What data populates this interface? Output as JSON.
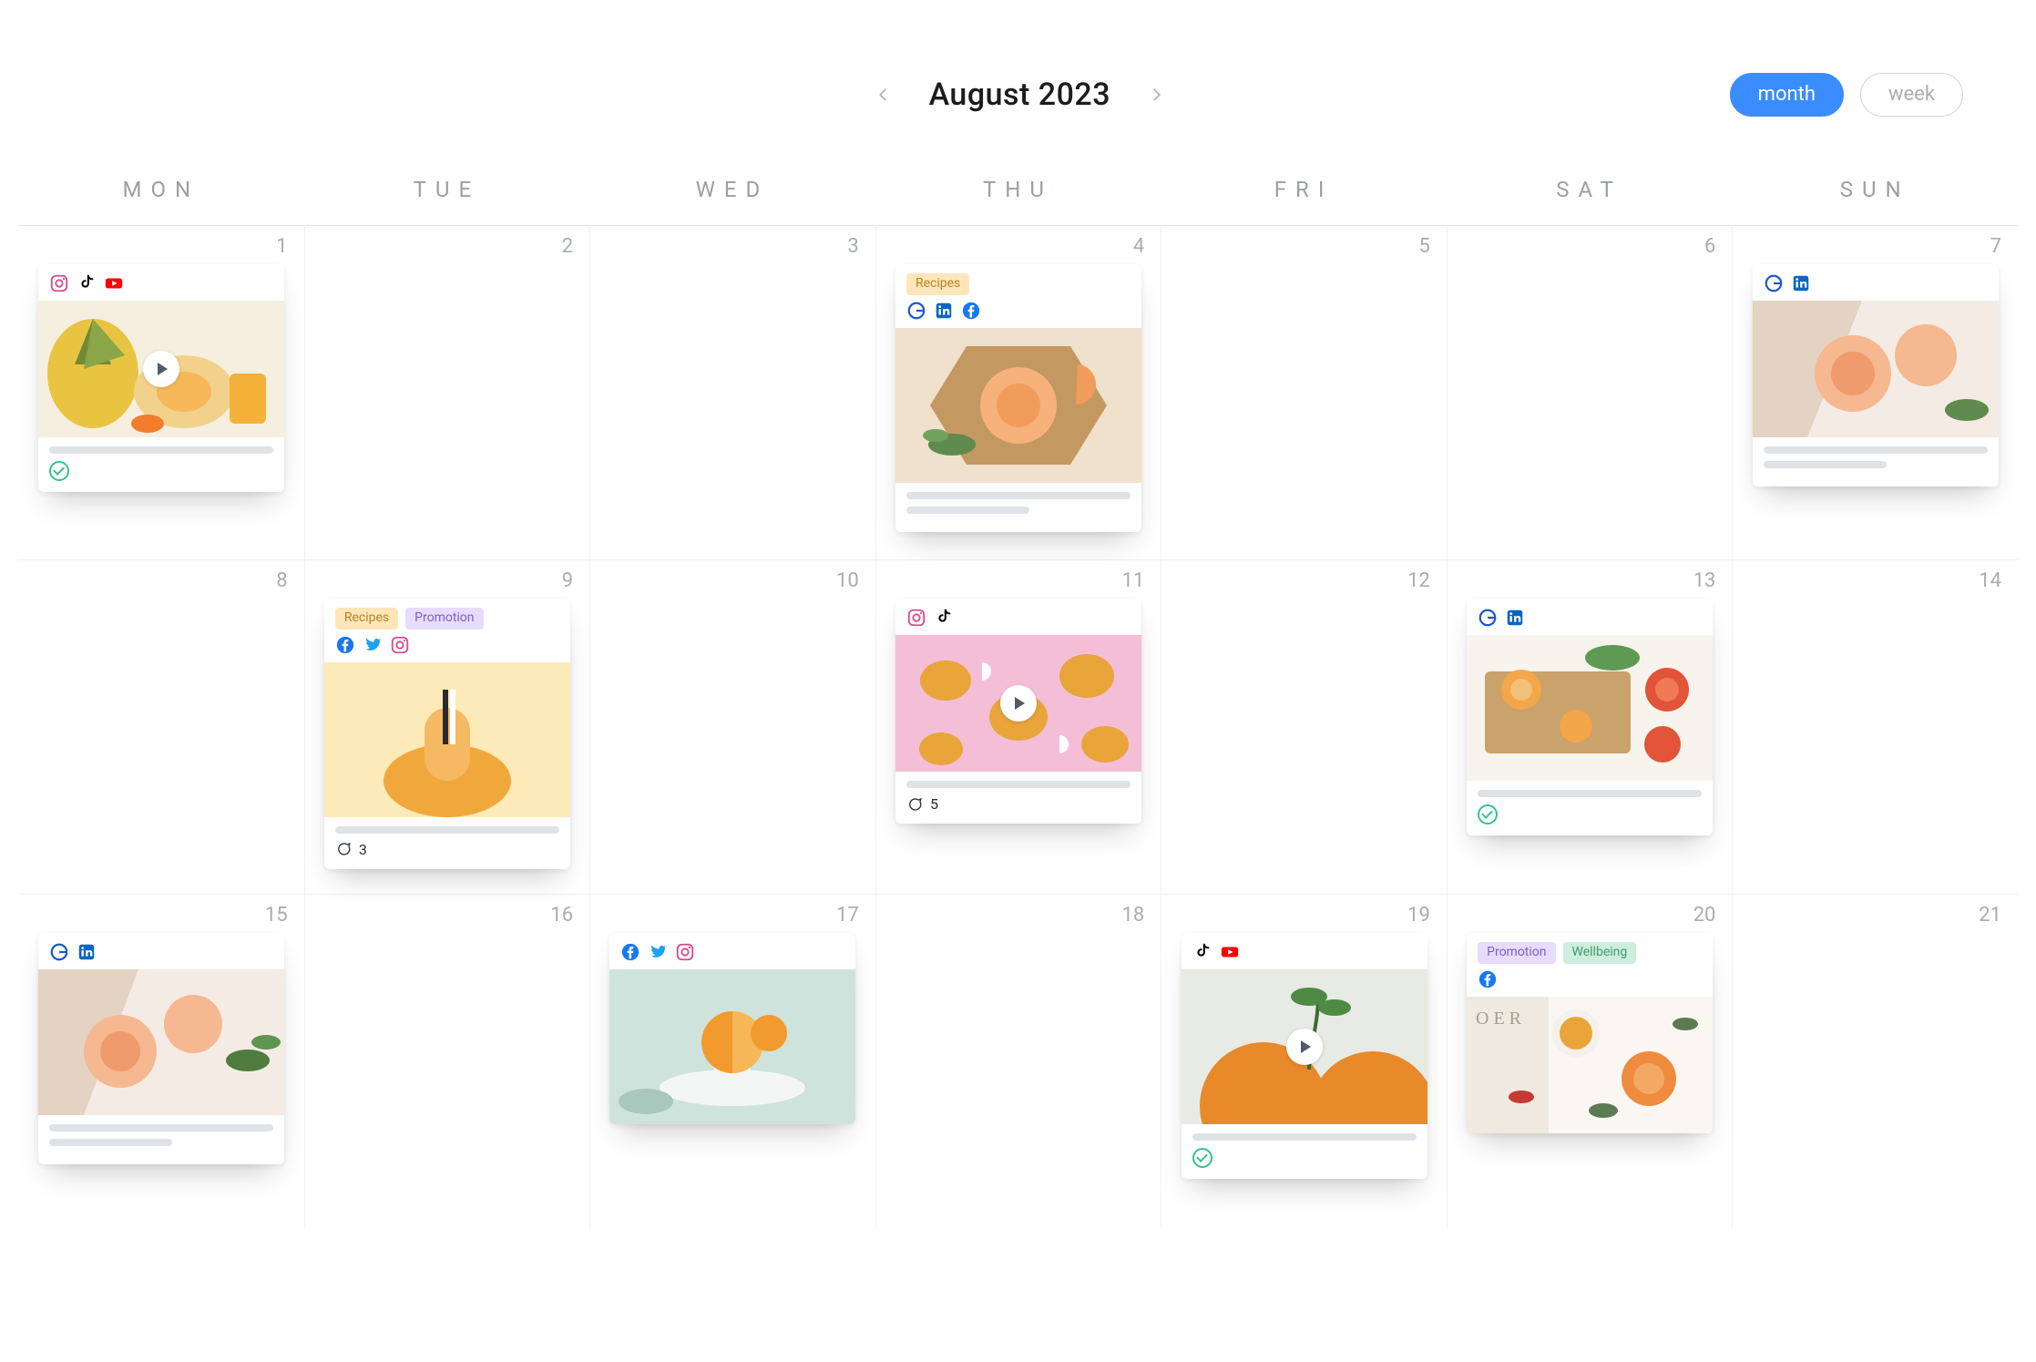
{
  "header": {
    "title": "August 2023",
    "view_month_label": "month",
    "view_week_label": "week"
  },
  "days_of_week": [
    "MON",
    "TUE",
    "WED",
    "THU",
    "FRI",
    "SAT",
    "SUN"
  ],
  "weeks": [
    [
      1,
      2,
      3,
      4,
      5,
      6,
      7
    ],
    [
      8,
      9,
      10,
      11,
      12,
      13,
      14
    ],
    [
      15,
      16,
      17,
      18,
      19,
      20,
      21
    ]
  ],
  "tags": {
    "recipes": "Recipes",
    "promotion": "Promotion",
    "wellbeing": "Wellbeing"
  },
  "posts": {
    "d1": {
      "channels": [
        "instagram",
        "tiktok",
        "youtube"
      ],
      "has_video": true,
      "tags": [],
      "footer": {
        "approved": true
      }
    },
    "d4": {
      "channels": [
        "google",
        "linkedin",
        "facebook"
      ],
      "has_video": false,
      "tags": [
        "recipes"
      ],
      "footer": {}
    },
    "d7": {
      "channels": [
        "google",
        "linkedin"
      ],
      "has_video": false,
      "tags": [],
      "footer": {}
    },
    "d9": {
      "channels": [
        "facebook",
        "twitter",
        "instagram"
      ],
      "has_video": false,
      "tags": [
        "recipes",
        "promotion"
      ],
      "footer": {
        "comments": 3
      }
    },
    "d11": {
      "channels": [
        "instagram",
        "tiktok"
      ],
      "has_video": true,
      "tags": [],
      "footer": {
        "comments": 5
      }
    },
    "d13": {
      "channels": [
        "google",
        "linkedin"
      ],
      "has_video": false,
      "tags": [],
      "footer": {
        "approved": true
      }
    },
    "d15": {
      "channels": [
        "google",
        "linkedin"
      ],
      "has_video": false,
      "tags": [],
      "footer": {}
    },
    "d17": {
      "channels": [
        "facebook",
        "twitter",
        "instagram"
      ],
      "has_video": false,
      "tags": [],
      "footer": {}
    },
    "d19": {
      "channels": [
        "tiktok",
        "youtube"
      ],
      "has_video": true,
      "tags": [],
      "footer": {
        "approved": true
      }
    },
    "d20": {
      "channels": [
        "facebook"
      ],
      "has_video": false,
      "tags": [
        "promotion",
        "wellbeing"
      ],
      "footer": {}
    }
  }
}
